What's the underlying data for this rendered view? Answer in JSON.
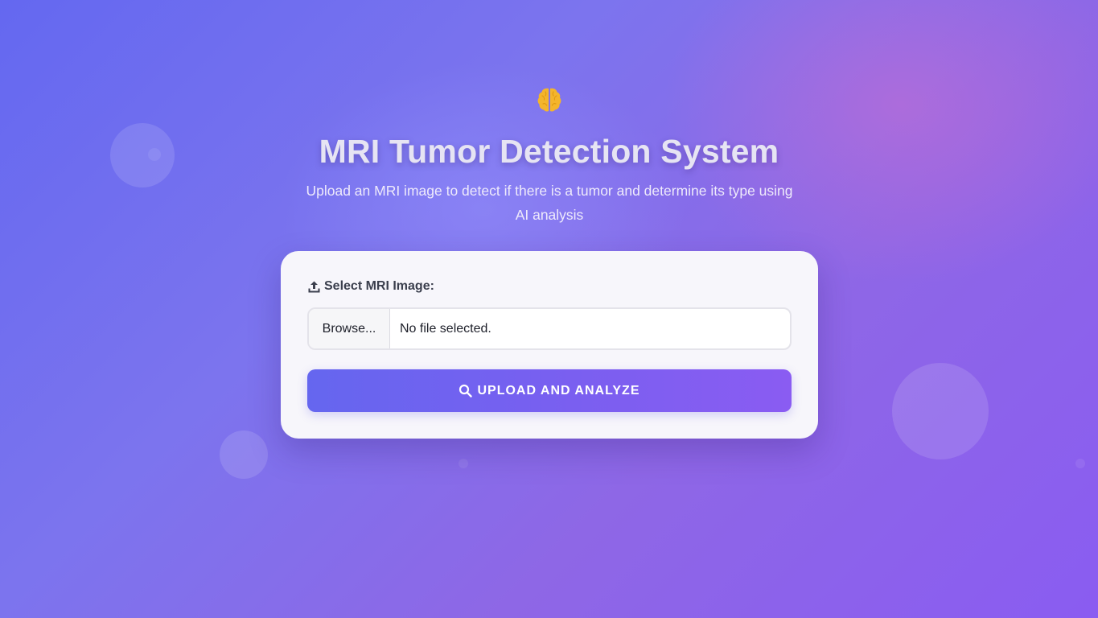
{
  "header": {
    "icon": "brain-icon",
    "title": "MRI Tumor Detection System",
    "subtitle": "Upload an MRI image to detect if there is a tumor and determine its type using AI analysis"
  },
  "form": {
    "label": "Select MRI Image:",
    "label_icon": "upload-icon",
    "browse_label": "Browse...",
    "file_status": "No file selected.",
    "submit_label": "UPLOAD AND ANALYZE",
    "submit_icon": "search-icon"
  },
  "colors": {
    "accent": "#6c63ef",
    "brain": "#f4b52b",
    "background_start": "#6468f0",
    "background_end": "#8a5cf1"
  }
}
